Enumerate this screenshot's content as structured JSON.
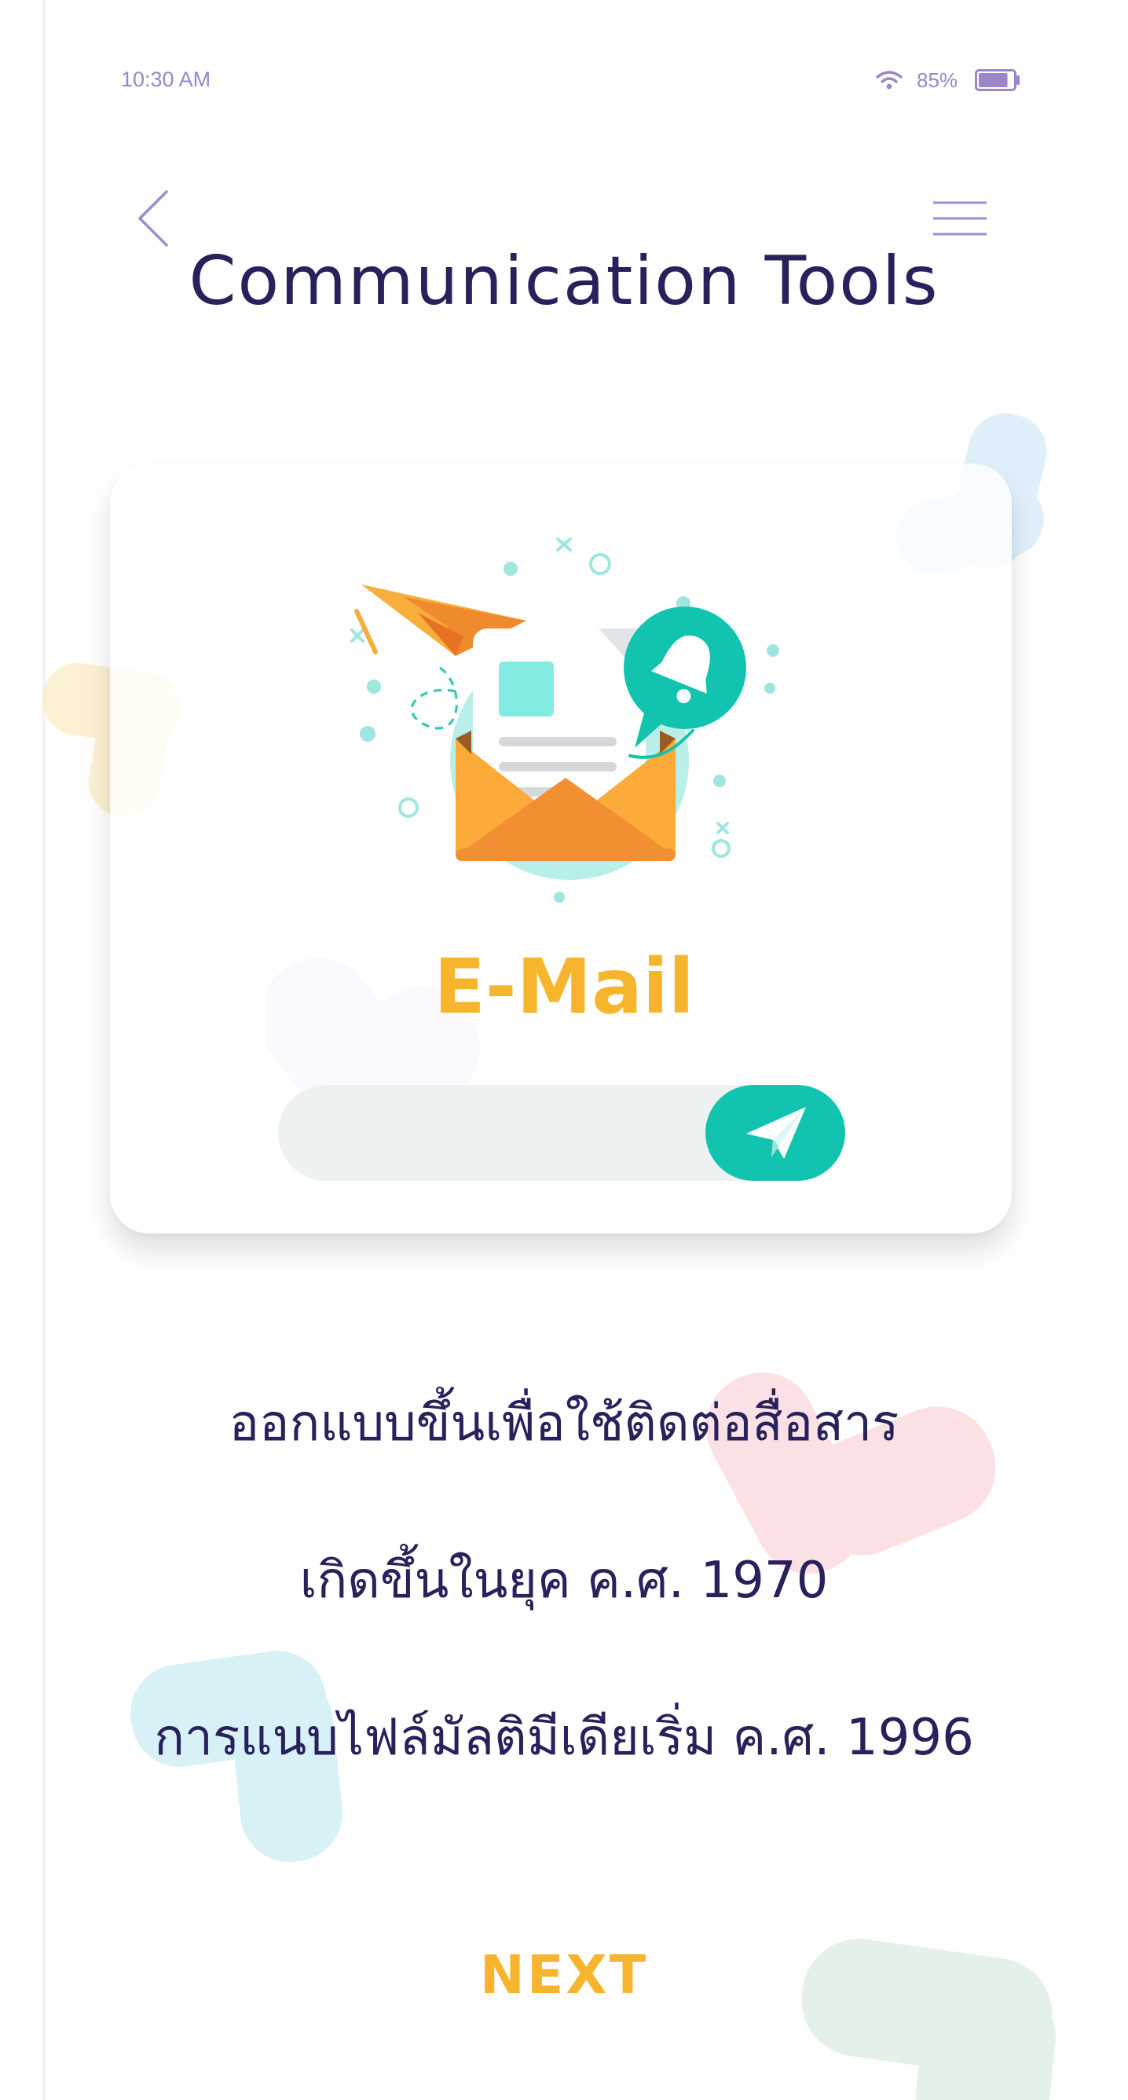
{
  "status_bar": {
    "time": "10:30 AM",
    "battery_percent": "85%",
    "battery_level": 0.85,
    "icons": [
      "wifi-icon",
      "battery-icon"
    ]
  },
  "header": {
    "back_icon": "chevron-left-icon",
    "menu_icon": "hamburger-menu-icon",
    "title": "Communication Tools"
  },
  "card": {
    "illustration": "email-envelope-illustration",
    "label": "E-Mail",
    "input_value": "",
    "send_icon": "paper-plane-icon"
  },
  "description": {
    "lines": [
      "ออกแบบขึ้นเพื่อใช้ติดต่อสื่อสาร",
      "เกิดขึ้นในยุค ค.ศ. 1970",
      "การแนบไฟล์มัลติมีเดียเริ่ม ค.ศ. 1996"
    ]
  },
  "footer": {
    "next_label": "NEXT"
  },
  "colors": {
    "title": "#27215c",
    "accent_yellow": "#f6b52d",
    "accent_teal": "#12c4b0",
    "status_purple": "#9a86c9"
  }
}
